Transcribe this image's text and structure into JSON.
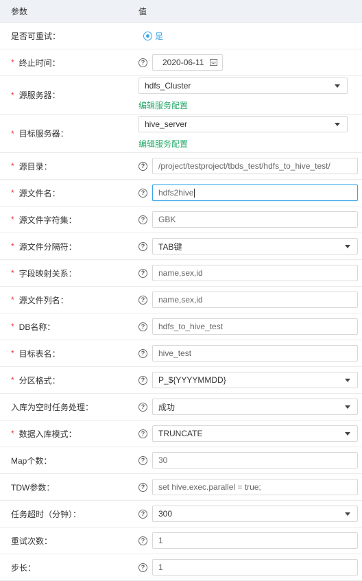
{
  "header": {
    "param": "参数",
    "value": "值"
  },
  "rows": [
    {
      "label": "是否可重试：",
      "required": false,
      "type": "radio",
      "value": "是"
    },
    {
      "label": "终止时间：",
      "required": true,
      "type": "date",
      "value": "2020-06-11"
    },
    {
      "label": "源服务器：",
      "required": true,
      "type": "select-link",
      "value": "hdfs_Cluster",
      "link": "编辑服务配置"
    },
    {
      "label": "目标服务器：",
      "required": true,
      "type": "select-link",
      "value": "hive_server",
      "link": "编辑服务配置"
    },
    {
      "label": "源目录：",
      "required": true,
      "type": "input",
      "value": "/project/testproject/tbds_test/hdfs_to_hive_test/"
    },
    {
      "label": "源文件名：",
      "required": true,
      "type": "input-focus",
      "value": "hdfs2hive"
    },
    {
      "label": "源文件字符集：",
      "required": true,
      "type": "input",
      "value": "GBK"
    },
    {
      "label": "源文件分隔符：",
      "required": true,
      "type": "select",
      "value": "TAB键"
    },
    {
      "label": "字段映射关系：",
      "required": true,
      "type": "input",
      "value": "name,sex,id"
    },
    {
      "label": "源文件列名：",
      "required": true,
      "type": "input",
      "value": "name,sex,id"
    },
    {
      "label": "DB名称：",
      "required": true,
      "type": "input",
      "value": "hdfs_to_hive_test"
    },
    {
      "label": "目标表名：",
      "required": true,
      "type": "input",
      "value": "hive_test"
    },
    {
      "label": "分区格式：",
      "required": true,
      "type": "select",
      "value": "P_${YYYYMMDD}"
    },
    {
      "label": "入库为空时任务处理：",
      "required": false,
      "type": "select",
      "value": "成功"
    },
    {
      "label": "数据入库模式：",
      "required": true,
      "type": "select",
      "value": "TRUNCATE"
    },
    {
      "label": "Map个数：",
      "required": false,
      "type": "input",
      "value": "30"
    },
    {
      "label": "TDW参数：",
      "required": false,
      "type": "input",
      "value": "set hive.exec.parallel = true;"
    },
    {
      "label": "任务超时（分钟）：",
      "required": false,
      "type": "select",
      "value": "300"
    },
    {
      "label": "重试次数：",
      "required": false,
      "type": "input",
      "value": "1"
    },
    {
      "label": "步长：",
      "required": false,
      "type": "input",
      "value": "1"
    }
  ],
  "star": "*",
  "help_glyph": "?"
}
